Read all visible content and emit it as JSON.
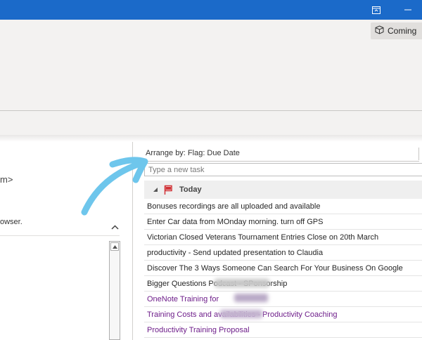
{
  "colors": {
    "titlebar": "#1b6ac9",
    "ribbon": "#f3f2f1",
    "flag_red": "#d13438",
    "category_purple": "#6e1e8a",
    "annotation_arrow": "#6ec6ec"
  },
  "window": {
    "restore_icon": "restore-window-icon",
    "minimize_icon": "minimize-icon"
  },
  "ribbon": {
    "coming_soon_label": "Coming",
    "coming_soon_icon": "cube-icon"
  },
  "left_pane": {
    "line1": "m>",
    "line2": "owser."
  },
  "tasks": {
    "arrange_label": "Arrange by: Flag: Due Date",
    "new_task_placeholder": "Type a new task",
    "group": {
      "title": "Today",
      "icon": "red-flag-icon"
    },
    "items": [
      {
        "text": "Bonuses recordings are all uploaded and available",
        "category": "none"
      },
      {
        "text": "Enter Car data from MOnday morning. turn off GPS",
        "category": "none"
      },
      {
        "text": "Victorian Closed Veterans Tournament Entries Close on 20th March",
        "category": "none"
      },
      {
        "text": "productivity - Send updated presentation to Claudia",
        "category": "none"
      },
      {
        "text": "Discover The 3 Ways Someone Can Search For Your Business On Google",
        "category": "none"
      },
      {
        "text": "Bigger Questions Podcast - SPonsorship",
        "category": "none"
      },
      {
        "text": "OneNote Training for",
        "category": "purple"
      },
      {
        "text": "Training Costs and availabilities - Productivity Coaching",
        "category": "purple"
      },
      {
        "text": "Productivity Training Proposal",
        "category": "purple"
      }
    ]
  }
}
